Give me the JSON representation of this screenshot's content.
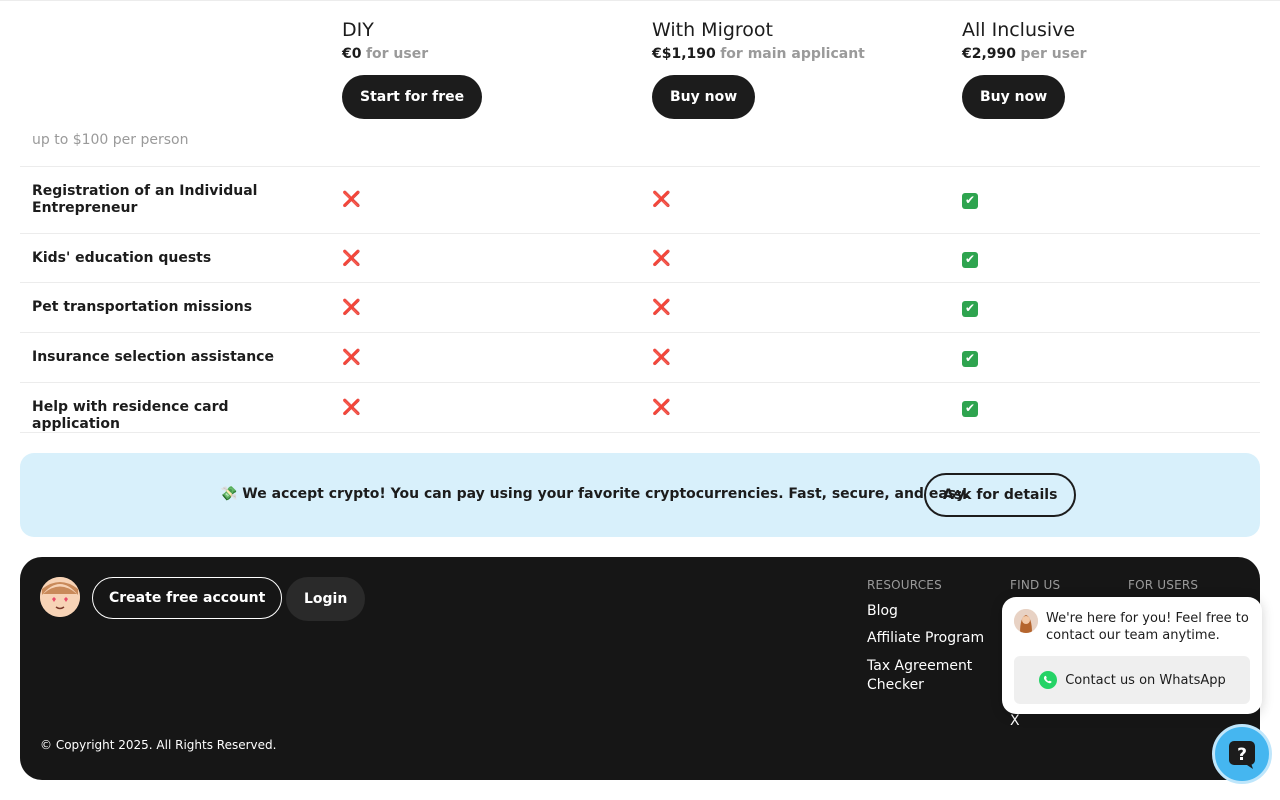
{
  "plans": [
    {
      "name": "DIY",
      "price": "€0",
      "unit": "for user",
      "button": "Start for free"
    },
    {
      "name": "With Migroot",
      "price": "€$1,190",
      "unit": "for main applicant",
      "button": "Buy now"
    },
    {
      "name": "All Inclusive",
      "price": "€2,990",
      "unit": "per user",
      "button": "Buy now"
    }
  ],
  "partial_row": {
    "label": "up to $100 per person"
  },
  "features": [
    {
      "label": "Registration of an Individual Entrepreneur",
      "diy": "❌",
      "migroot": "❌",
      "inclusive": "✔"
    },
    {
      "label": "Kids' education quests",
      "diy": "❌",
      "migroot": "❌",
      "inclusive": "✔"
    },
    {
      "label": "Pet transportation missions",
      "diy": "❌",
      "migroot": "❌",
      "inclusive": "✔"
    },
    {
      "label": "Insurance selection assistance",
      "diy": "❌",
      "migroot": "❌",
      "inclusive": "✔"
    },
    {
      "label": "Help with residence card application",
      "diy": "❌",
      "migroot": "❌",
      "inclusive": "✔"
    }
  ],
  "crypto_banner": {
    "text": "💸 We accept crypto! You can pay using your favorite cryptocurrencies. Fast, secure, and easy.",
    "button": "Ask for details"
  },
  "footer": {
    "create_account": "Create free account",
    "login": "Login",
    "resources_title": "RESOURCES",
    "resources": [
      "Blog",
      "Affiliate Program",
      "Tax Agreement Checker"
    ],
    "findus_title": "FIND US",
    "findus_visible": "X",
    "forusers_title": "FOR USERS",
    "copyright": "© Copyright 2025. All Rights Reserved."
  },
  "chat": {
    "message": "We're here for you! Feel free to contact our team anytime.",
    "whatsapp": "Contact us on WhatsApp"
  },
  "colors": {
    "accent_dark": "#1c1c1c",
    "banner_bg": "#d8f0fb",
    "footer_bg": "#161616",
    "help_button": "#45b6f0",
    "cross": "#e0312f",
    "check": "#2ea44f"
  }
}
